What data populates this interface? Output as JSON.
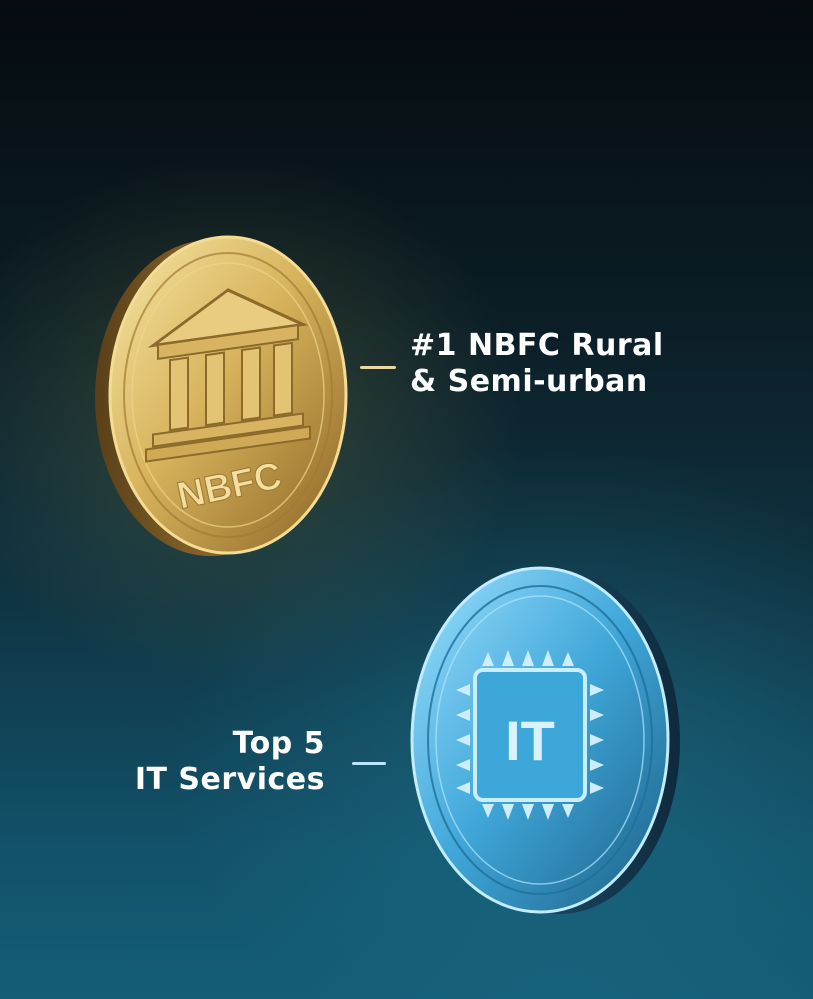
{
  "features": {
    "nbfc": {
      "line1": "#1 NBFC Rural",
      "line2": "& Semi-urban",
      "coin_text": "NBFC",
      "coin_icon": "bank-building-icon"
    },
    "it": {
      "line1": "Top 5",
      "line2": "IT Services",
      "coin_text": "IT",
      "coin_icon": "microchip-icon"
    }
  },
  "colors": {
    "gold": "#d7b15a",
    "blue": "#58b8e6",
    "text": "#ffffff"
  }
}
